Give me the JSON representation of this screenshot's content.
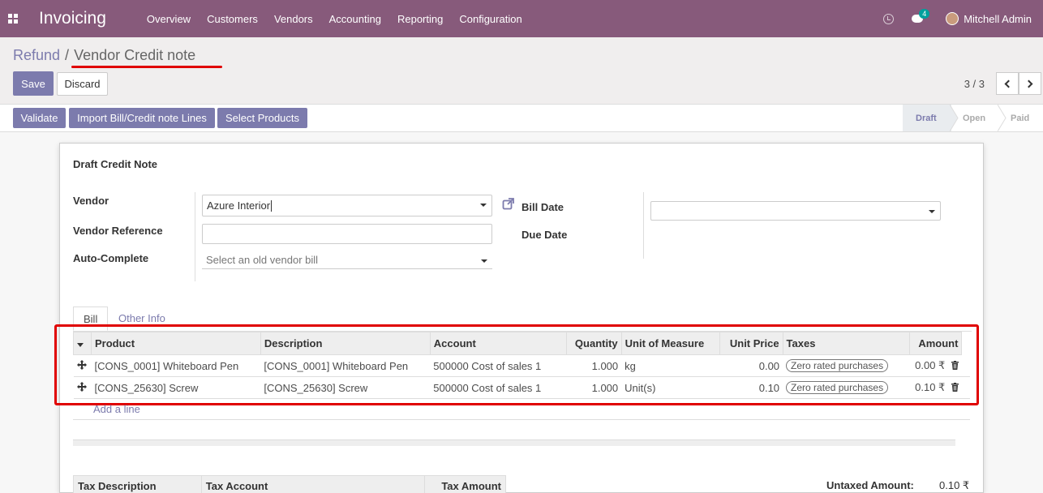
{
  "navbar": {
    "app_name": "Invoicing",
    "menu": [
      "Overview",
      "Customers",
      "Vendors",
      "Accounting",
      "Reporting",
      "Configuration"
    ],
    "chat_count": "4",
    "user_name": "Mitchell Admin"
  },
  "breadcrumb": {
    "parent": "Refund",
    "separator": "/",
    "current": "Vendor Credit note"
  },
  "buttons": {
    "save": "Save",
    "discard": "Discard",
    "validate": "Validate",
    "import_lines": "Import Bill/Credit note Lines",
    "select_products": "Select Products"
  },
  "pager": {
    "value": "3 / 3"
  },
  "status_steps": [
    "Draft",
    "Open",
    "Paid"
  ],
  "form": {
    "title": "Draft Credit Note",
    "vendor_label": "Vendor",
    "vendor_value": "Azure Interior",
    "vendor_ref_label": "Vendor Reference",
    "vendor_ref_value": "",
    "auto_complete_label": "Auto-Complete",
    "auto_complete_placeholder": "Select an old vendor bill",
    "bill_date_label": "Bill Date",
    "due_date_label": "Due Date"
  },
  "tabs": [
    "Bill",
    "Other Info"
  ],
  "lines": {
    "headers": [
      "Product",
      "Description",
      "Account",
      "Quantity",
      "Unit of Measure",
      "Unit Price",
      "Taxes",
      "Amount"
    ],
    "rows": [
      {
        "product": "[CONS_0001] Whiteboard Pen",
        "description": "[CONS_0001] Whiteboard Pen",
        "account": "500000 Cost of sales 1",
        "quantity": "1.000",
        "uom": "kg",
        "unit_price": "0.00",
        "taxes": "Zero rated purchases",
        "amount": "0.00 ₹"
      },
      {
        "product": "[CONS_25630] Screw",
        "description": "[CONS_25630] Screw",
        "account": "500000 Cost of sales 1",
        "quantity": "1.000",
        "uom": "Unit(s)",
        "unit_price": "0.10",
        "taxes": "Zero rated purchases",
        "amount": "0.10 ₹"
      }
    ],
    "add_line": "Add a line"
  },
  "tax_table": {
    "headers": [
      "Tax Description",
      "Tax Account",
      "Tax Amount"
    ]
  },
  "totals": {
    "untaxed_label": "Untaxed Amount:",
    "untaxed_value": "0.10 ₹"
  },
  "colors": {
    "navbar": "#875a7b",
    "primary": "#7c7bad",
    "highlight": "#e00000"
  }
}
